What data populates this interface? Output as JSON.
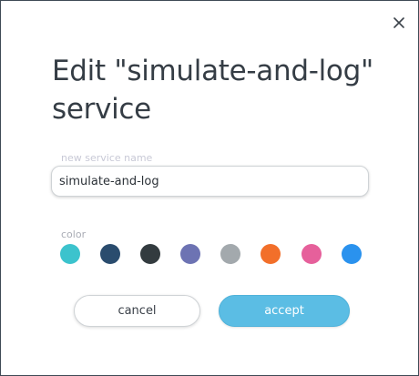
{
  "dialog": {
    "title": "Edit \"simulate-and-log\" service",
    "close_icon": "close-icon",
    "name_field": {
      "label": "new service name",
      "value": "simulate-and-log"
    },
    "color_section": {
      "label": "color",
      "swatches": [
        {
          "name": "teal",
          "hex": "#3cc3cd"
        },
        {
          "name": "navy",
          "hex": "#2a4c6e"
        },
        {
          "name": "charcoal",
          "hex": "#333b3f"
        },
        {
          "name": "lavender",
          "hex": "#6d73b3"
        },
        {
          "name": "gray",
          "hex": "#a3a9ad"
        },
        {
          "name": "orange",
          "hex": "#f26f2a"
        },
        {
          "name": "pink",
          "hex": "#e6609b"
        },
        {
          "name": "blue",
          "hex": "#2a92ee"
        }
      ]
    },
    "cancel_label": "cancel",
    "accept_label": "accept"
  }
}
